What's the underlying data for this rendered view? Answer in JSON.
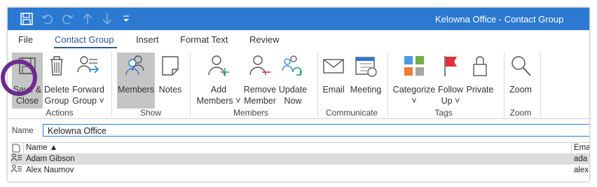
{
  "window": {
    "title": "Kelowna Office  -  Contact Group"
  },
  "qat": {
    "save_icon": "save-icon",
    "undo_icon": "undo-icon",
    "redo_icon": "redo-icon",
    "up_icon": "up-arrow-icon",
    "down_icon": "down-arrow-icon",
    "more_icon": "customize-qat-icon"
  },
  "tabs": [
    {
      "label": "File"
    },
    {
      "label": "Contact Group"
    },
    {
      "label": "Insert"
    },
    {
      "label": "Format Text"
    },
    {
      "label": "Review"
    }
  ],
  "ribbon": {
    "actions": {
      "group_label": "Actions",
      "save": [
        "Save &",
        "Close"
      ],
      "delete": [
        "Delete",
        "Group"
      ],
      "forward": [
        "Forward",
        "Group ˅"
      ]
    },
    "show": {
      "group_label": "Show",
      "members": "Members",
      "notes": "Notes"
    },
    "members": {
      "group_label": "Members",
      "add": [
        "Add",
        "Members ˅"
      ],
      "remove": [
        "Remove",
        "Member"
      ],
      "update": [
        "Update",
        "Now"
      ]
    },
    "communicate": {
      "group_label": "Communicate",
      "email": "Email",
      "meeting": "Meeting"
    },
    "tags": {
      "group_label": "Tags",
      "categorize": [
        "Categorize",
        "˅"
      ],
      "follow": [
        "Follow",
        "Up ˅"
      ],
      "private": "Private"
    },
    "zoom": {
      "group_label": "Zoom",
      "zoom": "Zoom"
    }
  },
  "name_field": {
    "label": "Name",
    "value": "Kelowna Office"
  },
  "list": {
    "headers": {
      "name": "Name ▲",
      "email": "Ema"
    },
    "rows": [
      {
        "name": "Adam Gibson",
        "email": "ada",
        "selected": true
      },
      {
        "name": "Alex Naumov",
        "email": "alex",
        "selected": false
      }
    ]
  },
  "colors": {
    "titlebar": "#2b79d0",
    "accent": "#2b579a",
    "annotation_circle": "#6c2b91"
  }
}
